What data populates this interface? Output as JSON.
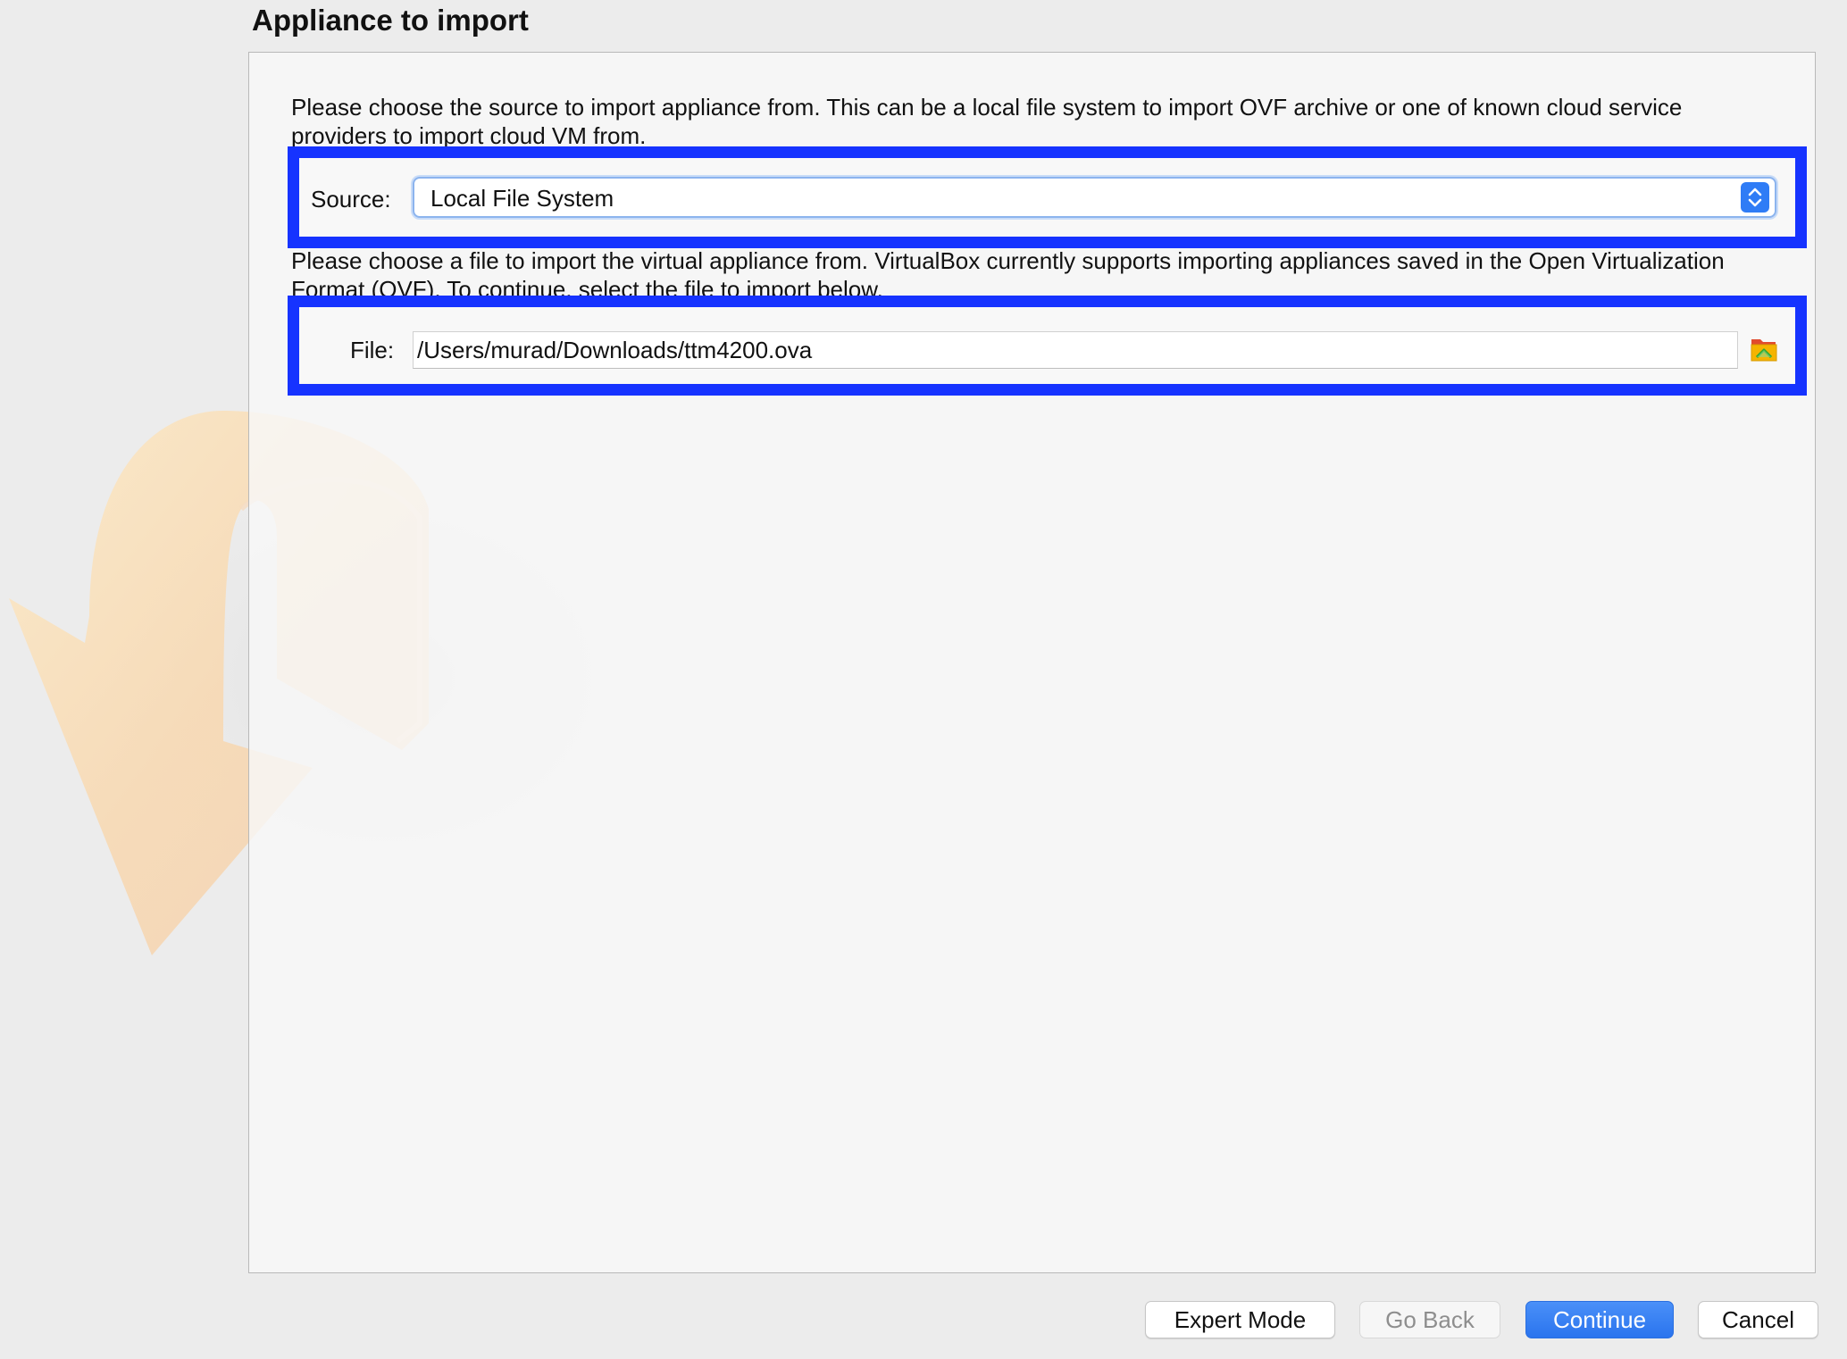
{
  "page": {
    "title": "Appliance to import"
  },
  "source_section": {
    "description": "Please choose the source to import appliance from. This can be a local file system to import OVF archive or one of known cloud service providers to import cloud VM from.",
    "label": "Source:",
    "selected_value": "Local File System",
    "control_icon": "up-down-chevron-icon"
  },
  "file_section": {
    "description": "Please choose a file to import the virtual appliance from. VirtualBox currently supports importing appliances saved in the Open Virtualization Format (OVF). To continue, select the file to import below.",
    "label": "File:",
    "value": "/Users/murad/Downloads/ttm4200.ova",
    "browse_icon": "folder-open-icon"
  },
  "buttons": {
    "expert_mode": "Expert Mode",
    "go_back": "Go Back",
    "continue": "Continue",
    "cancel": "Cancel"
  },
  "watermark_icon": "import-arrow-icon",
  "colors": {
    "highlight": "#1633ff",
    "primary_button": "#2f7cf6",
    "background": "#ececec"
  }
}
